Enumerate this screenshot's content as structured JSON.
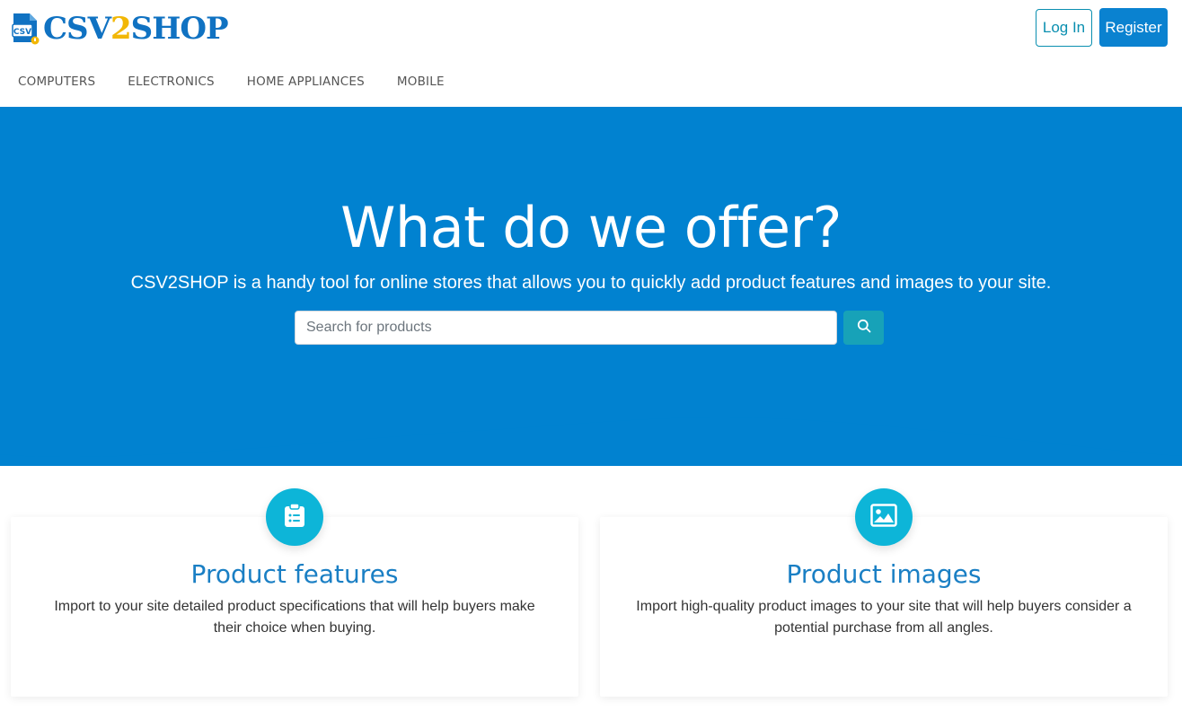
{
  "header": {
    "logo": {
      "part1": "CSV",
      "part2": "2",
      "part3": "SHOP",
      "icon_label": "CSV"
    },
    "login_label": "Log In",
    "register_label": "Register"
  },
  "nav": {
    "items": [
      {
        "label": "COMPUTERS"
      },
      {
        "label": "ELECTRONICS"
      },
      {
        "label": "HOME APPLIANCES"
      },
      {
        "label": "MOBILE"
      }
    ]
  },
  "hero": {
    "title": "What do we offer?",
    "subtitle": "CSV2SHOP is a handy tool for online stores that allows you to quickly add product features and images to your site.",
    "search": {
      "placeholder": "Search for products",
      "value": ""
    }
  },
  "features": [
    {
      "icon": "clipboard-list-icon",
      "title": "Product features",
      "text": "Import to your site detailed product specifications that will help buyers make their choice when buying."
    },
    {
      "icon": "image-icon",
      "title": "Product images",
      "text": "Import high-quality product images to your site that will help buyers consider a potential purchase from all angles."
    }
  ],
  "colors": {
    "brand_blue": "#0182d0",
    "logo_blue": "#1072c2",
    "logo_yellow": "#f2b705",
    "accent_teal": "#17a2b8",
    "badge_cyan": "#0db5d8",
    "card_title": "#1a7fc4"
  }
}
